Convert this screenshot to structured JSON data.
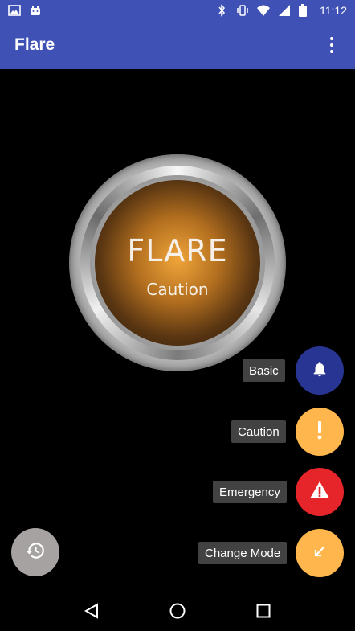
{
  "status_bar": {
    "time": "11:12",
    "left_icons": [
      "image-icon",
      "android-icon"
    ],
    "right_icons": [
      "bluetooth-icon",
      "vibrate-icon",
      "wifi-icon",
      "signal-icon",
      "battery-icon"
    ]
  },
  "app_bar": {
    "title": "Flare",
    "menu_icon": "more-vert-icon"
  },
  "flare_button": {
    "label": "FLARE",
    "mode": "Caution"
  },
  "speed_dial": [
    {
      "label": "Basic",
      "icon": "bell-icon",
      "color": "#283593"
    },
    {
      "label": "Caution",
      "icon": "exclamation-icon",
      "color": "#ffb74d"
    },
    {
      "label": "Emergency",
      "icon": "warning-icon",
      "color": "#e5252a"
    },
    {
      "label": "Change Mode",
      "icon": "arrow-down-left-icon",
      "color": "#ffb74d"
    }
  ],
  "history_button": {
    "icon": "history-icon",
    "color": "#a7a2a2"
  },
  "nav_bar": {
    "icons": [
      "back-icon",
      "home-icon",
      "recents-icon"
    ]
  }
}
